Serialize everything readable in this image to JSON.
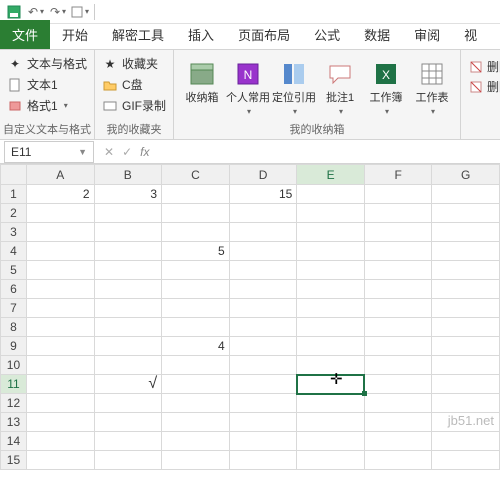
{
  "qat": {
    "save": "保存",
    "undo": "撤销",
    "redo": "重做"
  },
  "tabs": [
    "文件",
    "开始",
    "解密工具",
    "插入",
    "页面布局",
    "公式",
    "数据",
    "审阅",
    "视"
  ],
  "ribbon": {
    "grp1": {
      "label": "自定义文本与格式",
      "i1": "文本与格式",
      "i2": "文本1",
      "i3": "格式1"
    },
    "grp2": {
      "label": "我的收藏夹",
      "i1": "收藏夹",
      "i2": "C盘",
      "i3": "GIF录制"
    },
    "grp3": {
      "label": "我的收纳箱",
      "b1": "收纳箱",
      "b2": "个人常用",
      "b3": "定位引用",
      "b4": "批注1",
      "b5": "工作簿",
      "b6": "工作表"
    },
    "grp4": {
      "i1": "删除未",
      "i2": "删除选"
    }
  },
  "namebox": {
    "ref": "E11"
  },
  "fx": {
    "label": "fx"
  },
  "cols": [
    "A",
    "B",
    "C",
    "D",
    "E",
    "F",
    "G"
  ],
  "rows": [
    "1",
    "2",
    "3",
    "4",
    "5",
    "6",
    "7",
    "8",
    "9",
    "10",
    "11",
    "12",
    "13",
    "14",
    "15"
  ],
  "cells": {
    "A1": "2",
    "B1": "3",
    "D1": "15",
    "C4": "5",
    "C9": "4",
    "B11": "√"
  },
  "watermark": "jb51.net",
  "cursor": "✛"
}
